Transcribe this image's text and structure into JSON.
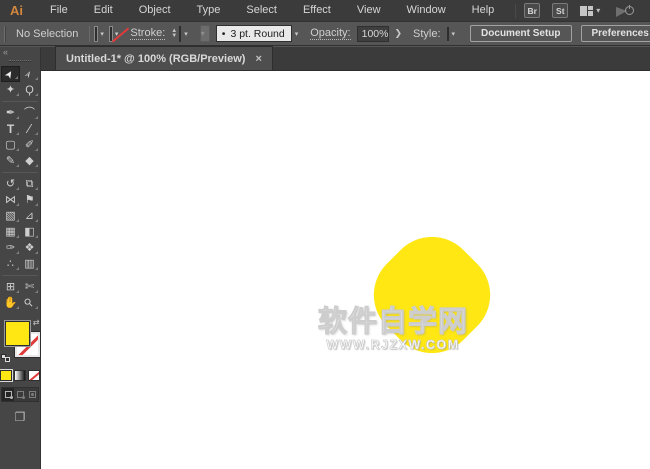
{
  "colors": {
    "accent_yellow": "#ffe714",
    "logo_orange": "#d3873e",
    "none_red": "#e03a3a"
  },
  "menubar": {
    "logo": "Ai",
    "items": [
      "File",
      "Edit",
      "Object",
      "Type",
      "Select",
      "Effect",
      "View",
      "Window",
      "Help"
    ],
    "bridge_button": "Br",
    "stock_button": "St",
    "icons": [
      "workspace-switcher",
      "chevron-down",
      "gpu-performance"
    ]
  },
  "controlbar": {
    "selection_status": "No Selection",
    "stroke_label": "Stroke:",
    "brush_preview": "•",
    "brush_label": "3 pt. Round",
    "opacity_label": "Opacity:",
    "opacity_value": "100%",
    "style_label": "Style:",
    "document_setup_button": "Document Setup",
    "preferences_button": "Preferences"
  },
  "tabbar": {
    "tabs": [
      {
        "title": "Untitled-1* @ 100% (RGB/Preview)",
        "close": "×"
      }
    ]
  },
  "toolbar": {
    "collapse_glyph": "«",
    "rows": [
      {
        "tools": [
          {
            "name": "selection-tool",
            "glyph": "➤",
            "active": true
          },
          {
            "name": "direct-selection-tool",
            "glyph": "➢"
          }
        ]
      },
      {
        "tools": [
          {
            "name": "magic-wand-tool",
            "glyph": "✦"
          },
          {
            "name": "lasso-tool",
            "glyph": "Ϙ"
          }
        ]
      },
      {
        "divider": true
      },
      {
        "tools": [
          {
            "name": "pen-tool",
            "glyph": "✒"
          },
          {
            "name": "curvature-tool",
            "glyph": "⌒"
          }
        ]
      },
      {
        "tools": [
          {
            "name": "type-tool",
            "glyph": "T"
          },
          {
            "name": "line-segment-tool",
            "glyph": "∕"
          }
        ]
      },
      {
        "tools": [
          {
            "name": "rectangle-tool",
            "glyph": "▢"
          },
          {
            "name": "paintbrush-tool",
            "glyph": "✐"
          }
        ]
      },
      {
        "tools": [
          {
            "name": "shaper-tool",
            "glyph": "✎"
          },
          {
            "name": "eraser-tool",
            "glyph": "◆"
          }
        ]
      },
      {
        "divider": true
      },
      {
        "tools": [
          {
            "name": "rotate-tool",
            "glyph": "↺"
          },
          {
            "name": "scale-tool",
            "glyph": "⧉"
          }
        ]
      },
      {
        "tools": [
          {
            "name": "width-tool",
            "glyph": "⋈"
          },
          {
            "name": "puppet-warp-tool",
            "glyph": "⚑"
          }
        ]
      },
      {
        "tools": [
          {
            "name": "free-transform-tool",
            "glyph": "▧"
          },
          {
            "name": "perspective-grid-tool",
            "glyph": "⊿"
          }
        ]
      },
      {
        "tools": [
          {
            "name": "mesh-tool",
            "glyph": "▦"
          },
          {
            "name": "gradient-tool",
            "glyph": "◧"
          }
        ]
      },
      {
        "tools": [
          {
            "name": "eyedropper-tool",
            "glyph": "✑"
          },
          {
            "name": "blend-tool",
            "glyph": "❖"
          }
        ]
      },
      {
        "tools": [
          {
            "name": "symbol-sprayer-tool",
            "glyph": "∴"
          },
          {
            "name": "graph-tool",
            "glyph": "▥"
          }
        ]
      },
      {
        "divider": true
      },
      {
        "tools": [
          {
            "name": "artboard-tool",
            "glyph": "⊞"
          },
          {
            "name": "slice-tool",
            "glyph": "✄"
          }
        ]
      },
      {
        "tools": [
          {
            "name": "hand-tool",
            "glyph": "✋"
          },
          {
            "name": "zoom-tool",
            "glyph": "⚲"
          }
        ]
      }
    ],
    "swap_glyph": "⇄",
    "screen_mode_glyph": "❐"
  },
  "canvas": {
    "shape": "yellow rounded-diamond blob",
    "watermark_line1": "软件自学网",
    "watermark_line2": "WWW.RJZXW.COM"
  }
}
